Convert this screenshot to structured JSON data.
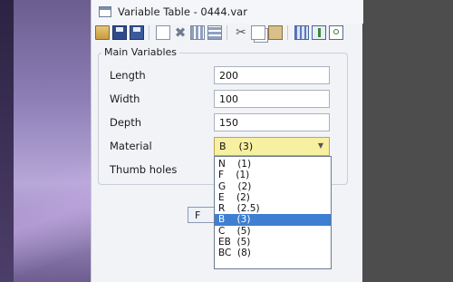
{
  "window": {
    "title": "Variable Table - 0444.var"
  },
  "toolbar": {
    "icons": [
      "open-icon",
      "save-icon",
      "save-as-icon",
      "new-icon",
      "delete-icon",
      "rows-icon",
      "columns-icon",
      "cut-icon",
      "copy-icon",
      "paste-icon",
      "table-icon",
      "insert-column-icon",
      "find-icon"
    ]
  },
  "group": {
    "legend": "Main Variables"
  },
  "fields": {
    "length": {
      "label": "Length",
      "value": "200"
    },
    "width": {
      "label": "Width",
      "value": "100"
    },
    "depth": {
      "label": "Depth",
      "value": "150"
    },
    "material": {
      "label": "Material",
      "value": "B    (3)"
    },
    "thumb_holes": {
      "label": "Thumb holes"
    }
  },
  "hidden_button": {
    "label": "F"
  },
  "dropdown": {
    "options": [
      "N    (1)",
      "F    (1)",
      "G    (2)",
      "E    (2)",
      "R    (2.5)",
      "B    (3)",
      "C    (5)",
      "EB  (5)",
      "BC  (8)"
    ],
    "selected_index": 5
  },
  "colors": {
    "accent": "#3f7fd1",
    "combo_bg": "#f7f0a0"
  }
}
